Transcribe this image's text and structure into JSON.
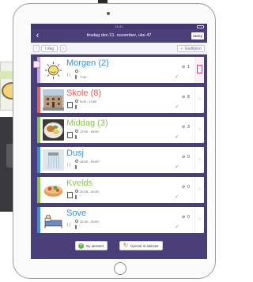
{
  "app": {
    "status_time": "11:41",
    "page_title": "tirsdag den 21. november, uke 47",
    "menu_label": "meny"
  },
  "toolbar": {
    "today_label": "I dag",
    "approve_label": "Godkjenn"
  },
  "activities": [
    {
      "name": "Morgen (2)",
      "color": "#3d8ed1",
      "time": "7:00",
      "count": "1",
      "accent": "#c9a7dd"
    },
    {
      "name": "Skole (8)",
      "color": "#e0615b",
      "time": "9:00 - 12:00",
      "count": "8",
      "accent": "#e0615b"
    },
    {
      "name": "Middag (3)",
      "color": "#8dc158",
      "time": "17:00 - 18:00",
      "count": "3",
      "accent": "#8dc158"
    },
    {
      "name": "Dusj",
      "color": "#3d8ed1",
      "time": "18:30 - 19:00",
      "count": "0",
      "accent": "#3d8ed1"
    },
    {
      "name": "Kvelds",
      "color": "#8dc158",
      "time": "20:15 - 20:30",
      "count": "0",
      "accent": "#8dc158"
    },
    {
      "name": "Sove",
      "color": "#3d8ed1",
      "time": "22:30 - 23:00",
      "count": "0",
      "accent": "#3d8ed1"
    }
  ],
  "bottombar": {
    "new_activity": "Ny aktivitet",
    "repeat_activity": "Gjenta/ sl aktivitet"
  },
  "icons": [
    "back-arrow-icon",
    "calendar-icon",
    "sun-icon",
    "clock-icon",
    "alarm-stand-icon",
    "checkmark-icon",
    "link-icon",
    "plus-icon",
    "repeat-icon"
  ]
}
